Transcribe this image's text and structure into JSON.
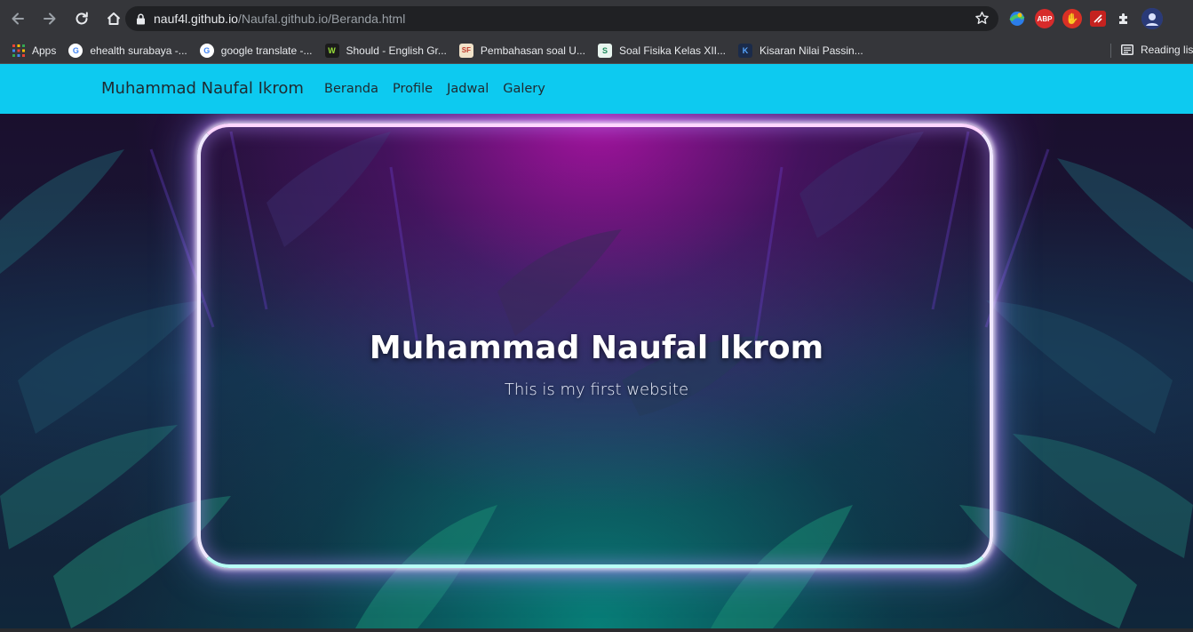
{
  "browser": {
    "url_host": "nauf4l.github.io",
    "url_path": "/Naufal.github.io/Beranda.html",
    "extensions": [
      {
        "name": "google-earth-extension-icon",
        "label": "",
        "color": "#3c8d3f"
      },
      {
        "name": "adblock-plus-icon",
        "label": "ABP",
        "color": "#d72b2b"
      },
      {
        "name": "hand-stop-extension-icon",
        "label": "✋",
        "color": "#d93025"
      },
      {
        "name": "red-extension-icon",
        "label": "⚡",
        "color": "#c5221f"
      },
      {
        "name": "extensions-puzzle-icon",
        "label": "",
        "color": "#35363a"
      },
      {
        "name": "profile-avatar-icon",
        "label": "",
        "color": "#3d4d8a"
      }
    ]
  },
  "bookmarks": {
    "apps_label": "Apps",
    "items": [
      {
        "label": "ehealth surabaya -...",
        "icon": "google-icon",
        "fav_bg": "#ffffff",
        "fav_fg": "#4285f4",
        "glyph": "G"
      },
      {
        "label": "google translate -...",
        "icon": "google-icon",
        "fav_bg": "#ffffff",
        "fav_fg": "#4285f4",
        "glyph": "G"
      },
      {
        "label": "Should - English Gr...",
        "icon": "wordreference-icon",
        "fav_bg": "#1b1b1b",
        "fav_fg": "#9be33a",
        "glyph": "W"
      },
      {
        "label": "Pembahasan soal U...",
        "icon": "sf-icon",
        "fav_bg": "#f2e3c9",
        "fav_fg": "#c0392b",
        "glyph": "SF"
      },
      {
        "label": "Soal Fisika Kelas XII...",
        "icon": "physics-site-icon",
        "fav_bg": "#e8f5ef",
        "fav_fg": "#1e8a5a",
        "glyph": "S"
      },
      {
        "label": "Kisaran Nilai Passin...",
        "icon": "blog-icon",
        "fav_bg": "#1b2b4a",
        "fav_fg": "#58a6ff",
        "glyph": "K"
      }
    ],
    "reading_list_label": "Reading list"
  },
  "site": {
    "brand": "Muhammad Naufal Ikrom",
    "nav": [
      {
        "label": "Beranda"
      },
      {
        "label": "Profile"
      },
      {
        "label": "Jadwal"
      },
      {
        "label": "Galery"
      }
    ],
    "hero_title": "Muhammad Naufal Ikrom",
    "hero_subtitle": "This is my first website"
  },
  "colors": {
    "navbar": "#0dcaf0",
    "chrome": "#35363a",
    "omnibox": "#202124"
  }
}
